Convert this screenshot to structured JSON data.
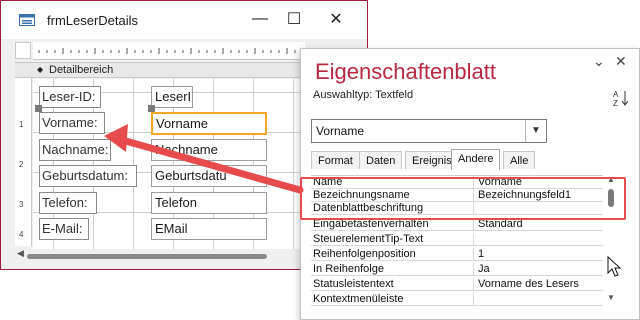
{
  "form_window": {
    "title": "frmLeserDetails",
    "controls": {
      "minimize": "—",
      "maximize": "☐",
      "close": "✕"
    },
    "section_label": "Detailbereich",
    "ruler_numbers": [
      "1",
      "2",
      "3",
      "4"
    ],
    "labels": [
      "Leser-ID:",
      "Vorname:",
      "Nachname:",
      "Geburtsdatum:",
      "Telefon:",
      "E-Mail:"
    ],
    "fields": [
      "LeserI",
      "Vorname",
      "Nachname",
      "Geburtsdatu",
      "Telefon",
      "EMail"
    ]
  },
  "property_sheet": {
    "title": "Eigenschaftenblatt",
    "selection_type": "Auswahltyp:  Textfeld",
    "selected_object": "Vorname",
    "tabs": [
      "Format",
      "Daten",
      "Ereignis",
      "Andere",
      "Alle"
    ],
    "active_tab": "Andere",
    "rows": [
      {
        "name": "Name",
        "value": "Vorname"
      },
      {
        "name": "Bezeichnungsname",
        "value": "Bezeichnungsfeld1"
      },
      {
        "name": "Datenblattbeschriftung",
        "value": ""
      },
      {
        "name": "Eingabetastenverhalten",
        "value": "Standard"
      },
      {
        "name": "SteuerelementTip-Text",
        "value": ""
      },
      {
        "name": "Reihenfolgenposition",
        "value": "1"
      },
      {
        "name": "In Reihenfolge",
        "value": "Ja"
      },
      {
        "name": "Statusleistentext",
        "value": "Vorname des Lesers"
      },
      {
        "name": "Kontextmenüleiste",
        "value": ""
      }
    ]
  },
  "colors": {
    "window_border": "#9b1c3a",
    "property_title": "#b8283f",
    "annotation_red": "#e74b4b",
    "selection_orange": "#f5a623"
  }
}
